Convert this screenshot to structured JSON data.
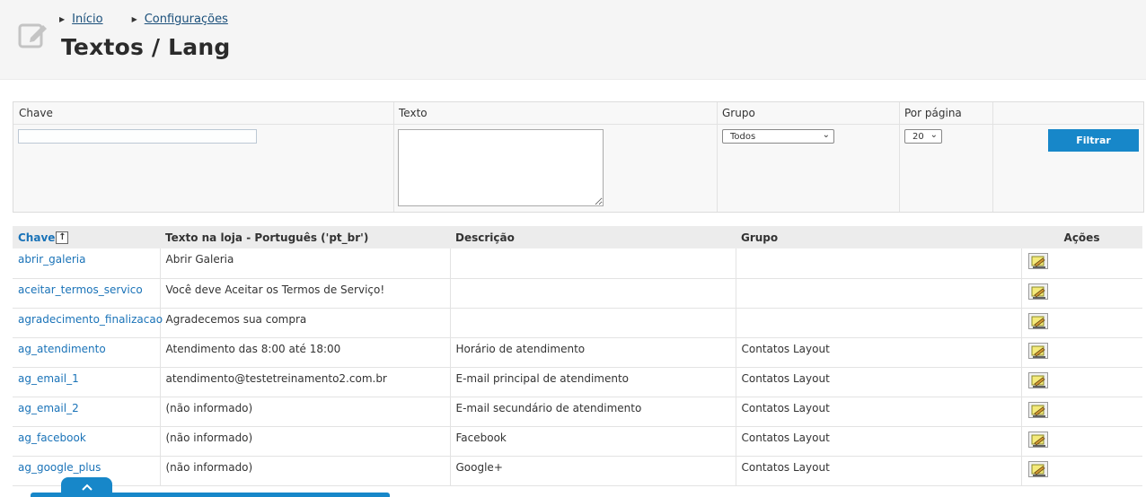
{
  "header": {
    "breadcrumb": [
      "Início",
      "Configurações"
    ],
    "title": "Textos / Lang"
  },
  "filter": {
    "labels": {
      "chave": "Chave",
      "texto": "Texto",
      "grupo": "Grupo",
      "por_pagina": "Por página"
    },
    "chave_value": "",
    "texto_value": "",
    "grupo_selected": "Todos",
    "por_pagina_selected": "20",
    "filtrar_label": "Filtrar"
  },
  "table": {
    "headers": {
      "chave": "Chave",
      "texto": "Texto na loja - Português ('pt_br')",
      "descricao": "Descrição",
      "grupo": "Grupo",
      "acoes": "Ações"
    },
    "rows": [
      {
        "chave": "abrir_galeria",
        "texto": "Abrir Galeria",
        "descricao": "",
        "grupo": ""
      },
      {
        "chave": "aceitar_termos_servico",
        "texto": "Você deve Aceitar os Termos de Serviço!",
        "descricao": "",
        "grupo": ""
      },
      {
        "chave": "agradecimento_finalizacao",
        "texto": "Agradecemos sua compra",
        "descricao": "",
        "grupo": ""
      },
      {
        "chave": "ag_atendimento",
        "texto": "Atendimento das 8:00 até 18:00",
        "descricao": "Horário de atendimento",
        "grupo": "Contatos Layout"
      },
      {
        "chave": "ag_email_1",
        "texto": "atendimento@testetreinamento2.com.br",
        "descricao": "E-mail principal de atendimento",
        "grupo": "Contatos Layout"
      },
      {
        "chave": "ag_email_2",
        "texto": "(não informado)",
        "descricao": "E-mail secundário de atendimento",
        "grupo": "Contatos Layout"
      },
      {
        "chave": "ag_facebook",
        "texto": "(não informado)",
        "descricao": "Facebook",
        "grupo": "Contatos Layout"
      },
      {
        "chave": "ag_google_plus",
        "texto": "(não informado)",
        "descricao": "Google+",
        "grupo": "Contatos Layout"
      }
    ]
  },
  "colors": {
    "accent": "#1787c9",
    "link": "#1a73b8"
  },
  "icons": {
    "page": "edit-square-icon",
    "row_action": "edit-pencil-icon",
    "sort": "arrow-up-icon",
    "bottom_tab": "chevron-up-icon"
  }
}
